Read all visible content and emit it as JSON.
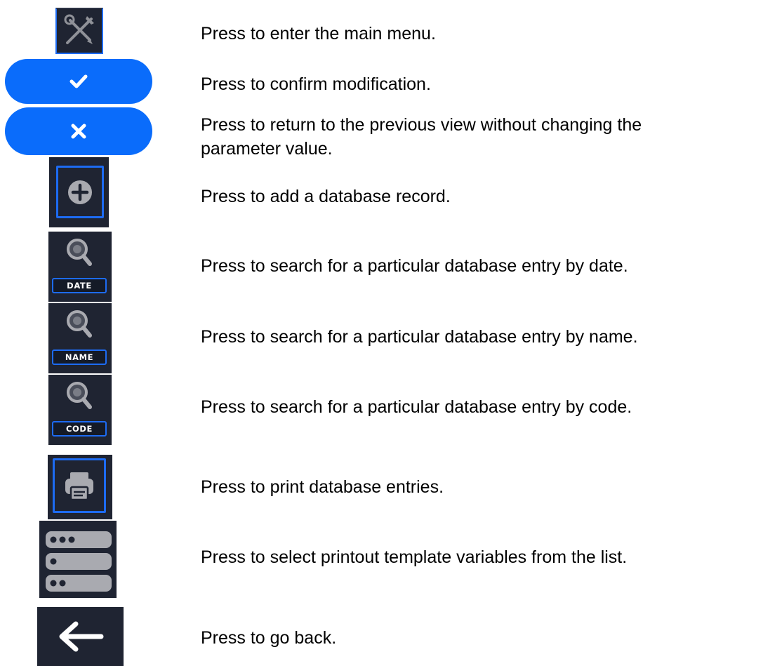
{
  "rows": [
    {
      "icon": "wrench-screwdriver-icon",
      "description": "Press to enter the main menu."
    },
    {
      "icon": "check-icon",
      "description": "Press to confirm modification."
    },
    {
      "icon": "x-icon",
      "description": "Press to return to the previous view without changing the",
      "description_line2": "parameter value."
    },
    {
      "icon": "plus-circle-icon",
      "description": "Press to add a database record."
    },
    {
      "icon": "search-icon",
      "label": "DATE",
      "description": "Press to search for a particular database entry by date."
    },
    {
      "icon": "search-icon",
      "label": "NAME",
      "description": "Press to search for a particular database entry by name."
    },
    {
      "icon": "search-icon",
      "label": "CODE",
      "description": "Press to search for a particular database entry by code."
    },
    {
      "icon": "printer-icon",
      "description": "Press to print database entries."
    },
    {
      "icon": "variables-list-icon",
      "description": "Press to select printout template variables from the list."
    },
    {
      "icon": "arrow-left-icon",
      "description": "Press to go back."
    }
  ],
  "colors": {
    "button_blue": "#0a6cfb",
    "frame_blue": "#1d6bf2",
    "dark_bg": "#1f2432",
    "icon_gray": "#a9aab0",
    "text": "#000000"
  }
}
